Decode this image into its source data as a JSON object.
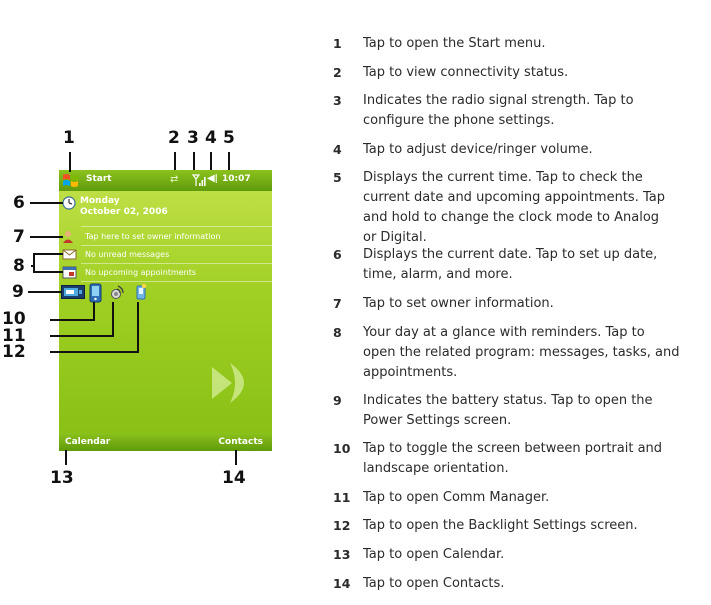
{
  "screen": {
    "title_bar": {
      "start_label": "Start",
      "clock": "10:07",
      "start_icon": "windows-flag-icon",
      "connectivity_icon": "connectivity-arrows-icon",
      "signal_icon": "signal-strength-icon",
      "volume_icon": "speaker-volume-icon"
    },
    "today": {
      "day": "Monday",
      "date": "October 02, 2006",
      "owner": "Tap here to set owner information",
      "messages": "No unread messages",
      "appointments": "No upcoming appointments"
    },
    "status_icons": [
      "battery-icon",
      "screen-rotate-icon",
      "comm-manager-icon",
      "backlight-icon"
    ],
    "softkeys": {
      "left": "Calendar",
      "right": "Contacts"
    }
  },
  "callouts": {
    "n1": "1",
    "n2": "2",
    "n3": "3",
    "n4": "4",
    "n5": "5",
    "n6": "6",
    "n7": "7",
    "n8": "8",
    "n9": "9",
    "n10": "10",
    "n11": "11",
    "n12": "12",
    "n13": "13",
    "n14": "14"
  },
  "descriptions": [
    {
      "num": "1",
      "lines": [
        "Tap to open the Start menu."
      ]
    },
    {
      "num": "2",
      "lines": [
        "Tap to view connectivity status."
      ]
    },
    {
      "num": "3",
      "lines": [
        "Indicates the radio signal strength. Tap to",
        "configure the phone settings."
      ]
    },
    {
      "num": "4",
      "lines": [
        "Tap to adjust device/ringer volume."
      ]
    },
    {
      "num": "5",
      "lines": [
        "Displays the current time. Tap to check the",
        "current date and upcoming appointments. Tap",
        "and hold to change the clock mode to Analog",
        "or Digital."
      ]
    },
    {
      "num": "6",
      "lines": [
        "Displays the current date. Tap to set up date,",
        "time, alarm, and more."
      ]
    },
    {
      "num": "7",
      "lines": [
        "Tap to set owner information."
      ]
    },
    {
      "num": "8",
      "lines": [
        "Your day at a glance with reminders. Tap to",
        "open the related program: messages, tasks, and",
        "appointments."
      ]
    },
    {
      "num": "9",
      "lines": [
        "Indicates the battery status. Tap to open the",
        "Power Settings screen."
      ]
    },
    {
      "num": "10",
      "lines": [
        "Tap to toggle the screen between portrait and",
        "landscape orientation."
      ]
    },
    {
      "num": "11",
      "lines": [
        "Tap to open Comm Manager."
      ]
    },
    {
      "num": "12",
      "lines": [
        "Tap to open the Backlight Settings screen."
      ]
    },
    {
      "num": "13",
      "lines": [
        "Tap to open Calendar."
      ]
    },
    {
      "num": "14",
      "lines": [
        "Tap to open Contacts."
      ]
    }
  ]
}
